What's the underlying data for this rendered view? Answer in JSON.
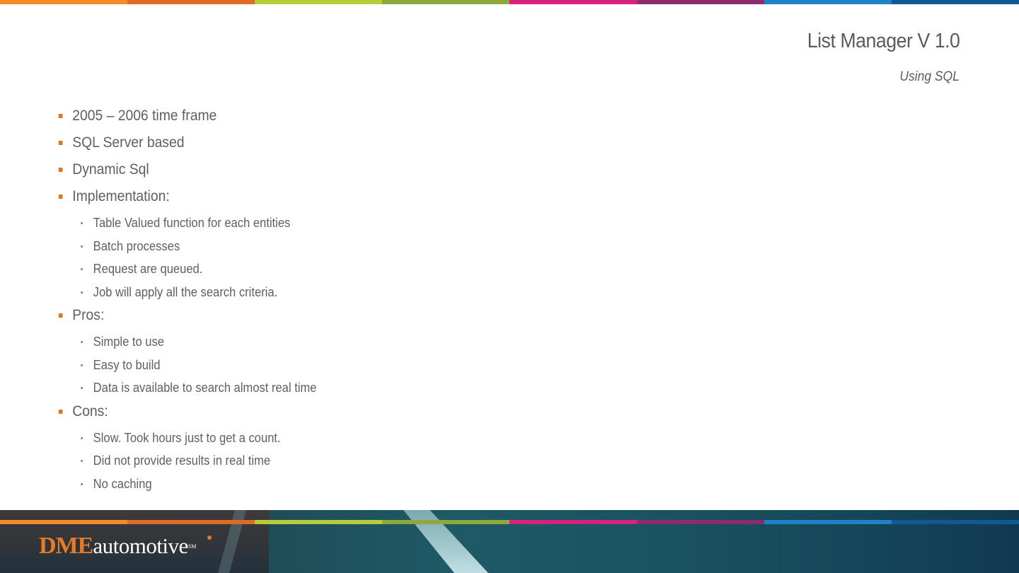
{
  "colors": {
    "stripe": [
      "#f58a26",
      "#e06a2a",
      "#b8cc3a",
      "#8fa83c",
      "#d6217f",
      "#8e2a6e",
      "#1e82c6",
      "#0f5a94"
    ],
    "bullet_marker": "#e0741f",
    "text": "#5f5f5f",
    "logo_accent": "#e87a26"
  },
  "slide": {
    "title": "List Manager V 1.0",
    "subtitle": "Using SQL"
  },
  "bullets": [
    {
      "level": 1,
      "text": "2005 – 2006 time frame"
    },
    {
      "level": 1,
      "text": "SQL Server based"
    },
    {
      "level": 1,
      "text": "Dynamic Sql"
    },
    {
      "level": 1,
      "text": "Implementation:"
    },
    {
      "level": 2,
      "text": "Table Valued function for each entities"
    },
    {
      "level": 2,
      "text": "Batch processes"
    },
    {
      "level": 2,
      "text": "Request are queued."
    },
    {
      "level": 2,
      "text": "Job will apply all the search criteria."
    },
    {
      "level": 1,
      "text": "Pros:"
    },
    {
      "level": 2,
      "text": "Simple to use"
    },
    {
      "level": 2,
      "text": "Easy to build"
    },
    {
      "level": 2,
      "text": "Data is available to search almost real time"
    },
    {
      "level": 1,
      "text": "Cons:"
    },
    {
      "level": 2,
      "text": "Slow. Took hours just to get a count."
    },
    {
      "level": 2,
      "text": "Did not provide results in real time"
    },
    {
      "level": 2,
      "text": "No caching"
    }
  ],
  "footer": {
    "logo_dme": "DME",
    "logo_automotive": "automotive",
    "logo_mark": "SM"
  }
}
